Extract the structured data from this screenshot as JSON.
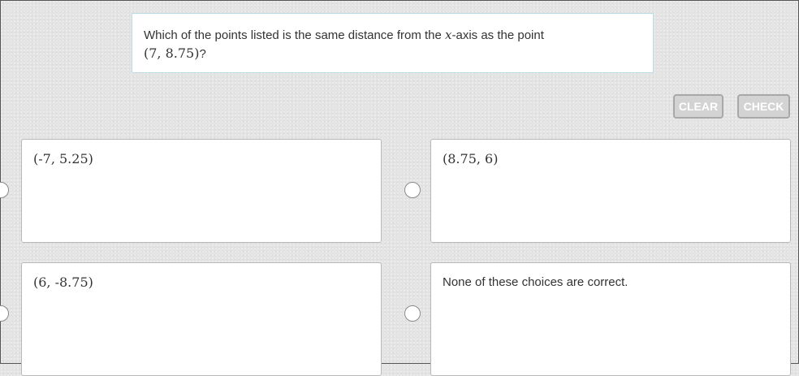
{
  "question": {
    "prefix": "Which of the points listed is the same distance from the ",
    "axis_var": "x",
    "suffix": "-axis as the point",
    "point": "(7,  8.75)",
    "end": "?"
  },
  "buttons": {
    "clear": "CLEAR",
    "check": "CHECK"
  },
  "choices": [
    {
      "text": "(-7,  5.25)"
    },
    {
      "text": "(8.75,  6)"
    },
    {
      "text": "(6,  -8.75)"
    },
    {
      "text": "None of these choices are correct."
    }
  ],
  "colors": {
    "button_bg": "#d3d3d3",
    "question_border": "#b9dbe3",
    "background": "#e4e4e4"
  }
}
